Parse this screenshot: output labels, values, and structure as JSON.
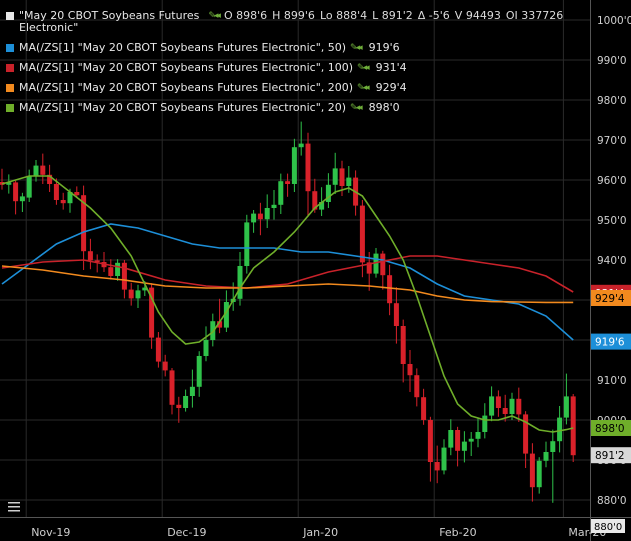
{
  "legend": {
    "main_name": "\"May 20 CBOT Soybeans Futures",
    "main_name_cont": "Electronic\"",
    "open": "O 898'6",
    "high": "H 899'6",
    "low": "Lo 888'4",
    "last": "L 891'2",
    "change": "Δ -5'6",
    "volume": "V 94493",
    "oi": "OI 337726",
    "ma": [
      {
        "label": "MA(/ZS[1] \"May 20 CBOT Soybeans Futures Electronic\", 50)",
        "value": "919'6",
        "color": "#1d8fd8"
      },
      {
        "label": "MA(/ZS[1] \"May 20 CBOT Soybeans Futures Electronic\", 100)",
        "value": "931'4",
        "color": "#c8222a"
      },
      {
        "label": "MA(/ZS[1] \"May 20 CBOT Soybeans Futures Electronic\", 200)",
        "value": "929'4",
        "color": "#f28a1e"
      },
      {
        "label": "MA(/ZS[1] \"May 20 CBOT Soybeans Futures Electronic\", 20)",
        "value": "898'0",
        "color": "#6fae2a"
      }
    ]
  },
  "price_badges": {
    "ma100": "931'4",
    "ma200": "929'4",
    "ma50": "919'6",
    "ma20": "898'0",
    "last": "891'2",
    "partial": "880'0"
  },
  "colors": {
    "up": "#2fc24a",
    "down": "#d9212a",
    "grid": "#2a2a2a",
    "axis_text": "#d0d0d0"
  },
  "chart_data": {
    "type": "candlestick",
    "ylim": [
      877,
      1003
    ],
    "y_ticks": [
      {
        "value": 1000,
        "label": "1000'0"
      },
      {
        "value": 990,
        "label": "990'0"
      },
      {
        "value": 980,
        "label": "980'0"
      },
      {
        "value": 970,
        "label": "970'0"
      },
      {
        "value": 960,
        "label": "960'0"
      },
      {
        "value": 950,
        "label": "950'0"
      },
      {
        "value": 940,
        "label": "940'0"
      },
      {
        "value": 930,
        "label": "930'0"
      },
      {
        "value": 920,
        "label": "920'0"
      },
      {
        "value": 910,
        "label": "910'0"
      },
      {
        "value": 900,
        "label": "900'0"
      },
      {
        "value": 890,
        "label": "890'0"
      },
      {
        "value": 880,
        "label": "880'0"
      }
    ],
    "x_ticks": [
      {
        "index": 4,
        "label": "Nov-19"
      },
      {
        "index": 24,
        "label": "Dec-19"
      },
      {
        "index": 44,
        "label": "Jan-20"
      },
      {
        "index": 64,
        "label": "Feb-20"
      },
      {
        "index": 83,
        "label": "Mar-20"
      }
    ],
    "bars": [
      [
        959.5,
        962.8,
        957.6,
        958.8
      ],
      [
        958.8,
        961.4,
        956.6,
        959.4
      ],
      [
        959.4,
        959.8,
        951.4,
        954.7
      ],
      [
        954.7,
        956.8,
        952.0,
        955.9
      ],
      [
        955.6,
        962.6,
        954.5,
        960.9
      ],
      [
        960.9,
        965.0,
        959.6,
        963.6
      ],
      [
        963.6,
        966.6,
        959.0,
        961.3
      ],
      [
        961.3,
        963.8,
        957.0,
        959.0
      ],
      [
        959.0,
        960.4,
        953.8,
        955.0
      ],
      [
        955.0,
        956.8,
        952.6,
        954.2
      ],
      [
        954.2,
        957.8,
        951.8,
        957.0
      ],
      [
        957.0,
        958.4,
        955.5,
        956.2
      ],
      [
        956.2,
        958.6,
        937.5,
        942.2
      ],
      [
        942.2,
        945.3,
        937.7,
        939.9
      ],
      [
        939.9,
        941.4,
        936.9,
        939.5
      ],
      [
        939.5,
        942.0,
        937.0,
        938.2
      ],
      [
        938.2,
        940.2,
        935.1,
        936.0
      ],
      [
        936.0,
        940.2,
        934.8,
        939.3
      ],
      [
        939.3,
        940.0,
        930.4,
        932.6
      ],
      [
        932.6,
        934.3,
        928.6,
        930.4
      ],
      [
        930.4,
        933.8,
        928.0,
        932.4
      ],
      [
        932.4,
        934.7,
        931.0,
        933.1
      ],
      [
        933.1,
        934.2,
        917.8,
        920.6
      ],
      [
        920.6,
        922.0,
        913.1,
        914.6
      ],
      [
        914.6,
        916.3,
        910.9,
        912.4
      ],
      [
        912.4,
        913.0,
        901.4,
        903.8
      ],
      [
        903.8,
        905.8,
        899.3,
        903.0
      ],
      [
        903.0,
        907.6,
        902.1,
        906.0
      ],
      [
        906.0,
        912.6,
        903.1,
        908.3
      ],
      [
        908.3,
        917.2,
        905.8,
        916.0
      ],
      [
        916.0,
        923.4,
        914.7,
        920.0
      ],
      [
        920.0,
        926.6,
        918.4,
        924.7
      ],
      [
        924.7,
        930.3,
        921.7,
        923.1
      ],
      [
        923.1,
        932.4,
        922.0,
        929.5
      ],
      [
        929.5,
        934.4,
        927.3,
        930.3
      ],
      [
        930.3,
        942.0,
        928.6,
        938.5
      ],
      [
        938.5,
        951.3,
        936.6,
        949.4
      ],
      [
        949.4,
        952.5,
        946.8,
        951.6
      ],
      [
        951.6,
        954.3,
        946.2,
        950.2
      ],
      [
        950.2,
        956.4,
        948.0,
        953.0
      ],
      [
        953.0,
        957.5,
        950.1,
        953.8
      ],
      [
        953.8,
        961.6,
        951.5,
        959.7
      ],
      [
        959.7,
        961.6,
        955.8,
        959.0
      ],
      [
        959.0,
        970.3,
        957.0,
        968.2
      ],
      [
        968.2,
        974.6,
        966.1,
        969.1
      ],
      [
        969.1,
        971.8,
        950.8,
        957.2
      ],
      [
        957.2,
        960.3,
        951.8,
        952.6
      ],
      [
        952.6,
        958.2,
        951.0,
        954.5
      ],
      [
        954.5,
        961.7,
        953.0,
        958.8
      ],
      [
        958.8,
        966.8,
        956.5,
        962.9
      ],
      [
        962.9,
        964.8,
        956.0,
        958.5
      ],
      [
        958.5,
        963.5,
        956.8,
        960.6
      ],
      [
        960.6,
        962.4,
        951.1,
        953.6
      ],
      [
        953.6,
        955.0,
        935.7,
        939.4
      ],
      [
        939.4,
        942.0,
        932.3,
        936.6
      ],
      [
        936.6,
        943.0,
        935.6,
        941.6
      ],
      [
        941.6,
        942.3,
        932.6,
        936.2
      ],
      [
        936.2,
        938.8,
        926.2,
        929.2
      ],
      [
        929.2,
        933.2,
        919.1,
        923.5
      ],
      [
        923.5,
        925.1,
        909.4,
        914.0
      ],
      [
        914.0,
        917.5,
        907.0,
        911.2
      ],
      [
        911.2,
        912.9,
        903.4,
        905.7
      ],
      [
        905.7,
        907.8,
        898.8,
        900.0
      ],
      [
        900.0,
        900.8,
        884.6,
        889.5
      ],
      [
        889.5,
        893.6,
        884.2,
        887.4
      ],
      [
        887.4,
        895.2,
        886.4,
        893.1
      ],
      [
        893.1,
        900.2,
        891.2,
        897.5
      ],
      [
        897.5,
        898.3,
        888.4,
        892.3
      ],
      [
        892.3,
        897.2,
        889.4,
        894.6
      ],
      [
        894.6,
        897.0,
        891.0,
        895.3
      ],
      [
        895.3,
        900.4,
        893.2,
        897.0
      ],
      [
        897.0,
        904.2,
        895.4,
        901.1
      ],
      [
        901.1,
        908.4,
        899.7,
        905.9
      ],
      [
        905.9,
        907.4,
        900.8,
        903.0
      ],
      [
        903.0,
        906.3,
        899.6,
        901.5
      ],
      [
        901.5,
        906.8,
        900.0,
        905.3
      ],
      [
        905.3,
        908.1,
        899.5,
        901.4
      ],
      [
        901.4,
        902.2,
        888.0,
        891.6
      ],
      [
        891.6,
        894.2,
        879.6,
        883.2
      ],
      [
        883.2,
        890.7,
        881.6,
        889.8
      ],
      [
        889.8,
        894.6,
        888.2,
        892.0
      ],
      [
        892.0,
        897.6,
        879.3,
        894.7
      ],
      [
        894.7,
        903.5,
        891.9,
        900.6
      ],
      [
        900.6,
        911.6,
        898.9,
        905.9
      ],
      [
        905.9,
        906.5,
        889.5,
        891.2
      ]
    ],
    "ma": [
      {
        "name": "MA50",
        "color": "#1d8fd8",
        "points": [
          [
            0,
            934
          ],
          [
            4,
            939
          ],
          [
            8,
            944
          ],
          [
            12,
            947
          ],
          [
            16,
            949
          ],
          [
            20,
            948
          ],
          [
            24,
            946
          ],
          [
            28,
            944
          ],
          [
            32,
            943
          ],
          [
            36,
            943
          ],
          [
            40,
            943
          ],
          [
            44,
            942
          ],
          [
            48,
            942
          ],
          [
            52,
            941
          ],
          [
            56,
            940
          ],
          [
            60,
            938
          ],
          [
            64,
            934
          ],
          [
            68,
            931
          ],
          [
            72,
            930
          ],
          [
            76,
            929
          ],
          [
            80,
            926
          ],
          [
            84,
            920
          ]
        ]
      },
      {
        "name": "MA100",
        "color": "#c8222a",
        "points": [
          [
            0,
            938
          ],
          [
            6,
            939.5
          ],
          [
            12,
            940
          ],
          [
            18,
            938
          ],
          [
            24,
            935
          ],
          [
            30,
            933.5
          ],
          [
            36,
            933
          ],
          [
            42,
            934
          ],
          [
            48,
            937
          ],
          [
            54,
            939
          ],
          [
            60,
            941
          ],
          [
            64,
            941
          ],
          [
            68,
            940
          ],
          [
            72,
            939
          ],
          [
            76,
            938
          ],
          [
            80,
            936
          ],
          [
            84,
            932
          ]
        ]
      },
      {
        "name": "MA200",
        "color": "#f28a1e",
        "points": [
          [
            0,
            938.5
          ],
          [
            6,
            937.5
          ],
          [
            12,
            936
          ],
          [
            18,
            935
          ],
          [
            24,
            933.5
          ],
          [
            30,
            933
          ],
          [
            36,
            933
          ],
          [
            42,
            933.5
          ],
          [
            48,
            934
          ],
          [
            54,
            933.5
          ],
          [
            60,
            932.5
          ],
          [
            64,
            931
          ],
          [
            68,
            930
          ],
          [
            72,
            929.6
          ],
          [
            76,
            929.5
          ],
          [
            80,
            929.4
          ],
          [
            84,
            929.4
          ]
        ]
      },
      {
        "name": "MA20",
        "color": "#6fae2a",
        "points": [
          [
            0,
            959
          ],
          [
            4,
            961
          ],
          [
            7,
            961
          ],
          [
            10,
            957
          ],
          [
            13,
            953
          ],
          [
            16,
            948
          ],
          [
            19,
            941
          ],
          [
            21,
            934
          ],
          [
            23,
            927
          ],
          [
            25,
            922
          ],
          [
            27,
            919
          ],
          [
            29,
            919.5
          ],
          [
            31,
            922
          ],
          [
            33,
            927
          ],
          [
            35,
            933
          ],
          [
            37,
            938
          ],
          [
            40,
            942
          ],
          [
            43,
            947
          ],
          [
            46,
            953
          ],
          [
            49,
            957
          ],
          [
            51,
            958
          ],
          [
            53,
            956
          ],
          [
            55,
            951
          ],
          [
            57,
            946
          ],
          [
            59,
            940
          ],
          [
            61,
            931
          ],
          [
            63,
            921
          ],
          [
            65,
            911
          ],
          [
            67,
            904
          ],
          [
            69,
            901
          ],
          [
            71,
            900
          ],
          [
            73,
            900
          ],
          [
            75,
            901
          ],
          [
            77,
            899.5
          ],
          [
            79,
            897.5
          ],
          [
            81,
            897
          ],
          [
            83,
            897.6
          ],
          [
            84,
            898
          ]
        ]
      }
    ]
  }
}
